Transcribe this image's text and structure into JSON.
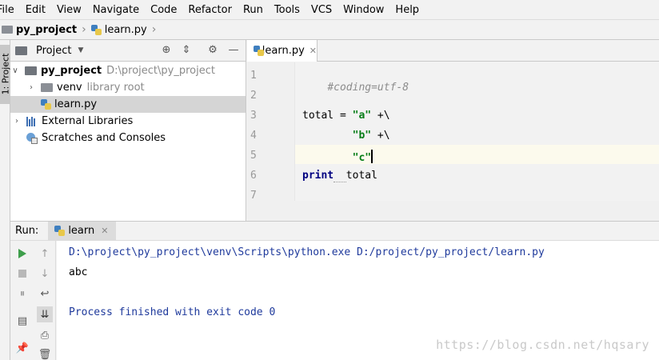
{
  "menu": [
    "File",
    "Edit",
    "View",
    "Navigate",
    "Code",
    "Refactor",
    "Run",
    "Tools",
    "VCS",
    "Window",
    "Help"
  ],
  "breadcrumb": {
    "project": "py_project",
    "file": "learn.py"
  },
  "left_strip": {
    "project_tab": "1: Project"
  },
  "project_panel": {
    "title": "Project",
    "tree": {
      "root": {
        "name": "py_project",
        "path": "D:\\project\\py_project"
      },
      "venv": {
        "name": "venv",
        "note": "library root"
      },
      "file": {
        "name": "learn.py"
      },
      "external": {
        "name": "External Libraries"
      },
      "scratches": {
        "name": "Scratches and Consoles"
      }
    }
  },
  "editor": {
    "tab": "learn.py",
    "line_numbers": [
      "1",
      "2",
      "3",
      "4",
      "5",
      "6",
      "7"
    ],
    "code": {
      "l1": "#coding=utf-8",
      "l3_a": "total = ",
      "l3_s": "\"a\"",
      "l3_b": " +\\",
      "l4_s": "\"b\"",
      "l4_b": " +\\",
      "l5_s": "\"c\"",
      "l6_kw": "print",
      "l6_b": "total"
    }
  },
  "run_panel": {
    "label": "Run:",
    "tab": "learn",
    "output": {
      "command": "D:\\project\\py_project\\venv\\Scripts\\python.exe D:/project/py_project/learn.py",
      "result": "abc",
      "exit": "Process finished with exit code 0"
    }
  },
  "watermark": "https://blog.csdn.net/hqsary",
  "colors": {
    "string": "#067d17",
    "keyword": "#000080",
    "comment": "#8c8c8c",
    "console_blue": "#1f3a9c",
    "run_green": "#3e9e4b"
  },
  "icons": [
    "folder-icon",
    "python-file-icon",
    "library-icon",
    "scratch-icon",
    "globe-icon",
    "collapse-icon",
    "gear-icon",
    "minimize-icon",
    "play-icon",
    "stop-icon",
    "pin-icon"
  ]
}
